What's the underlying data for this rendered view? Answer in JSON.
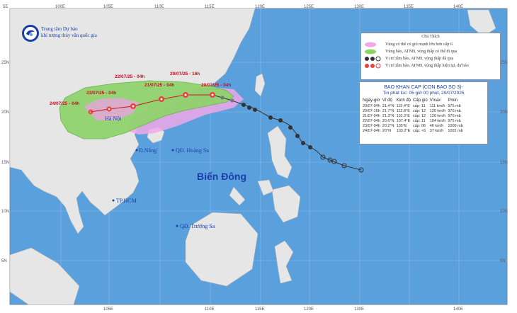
{
  "org": {
    "line1": "Trung tâm Dự báo",
    "line2": "khí tượng thủy văn quốc gia"
  },
  "axes": {
    "lon_top": [
      "5E",
      "100E",
      "105E",
      "110E",
      "115E",
      "120E",
      "125E",
      "130E",
      "135E",
      "140E"
    ],
    "lon_bottom": [
      "105E",
      "110E",
      "115E",
      "120E",
      "130E",
      "140E"
    ],
    "lat_left": [
      "25N",
      "20N",
      "15N",
      "10N",
      "5N"
    ],
    "lat_right": [
      "25N",
      "20N",
      "15N",
      "10N",
      "5N"
    ]
  },
  "legend": {
    "title": "Chú Thích",
    "items": [
      {
        "text": "Vùng có thể có gió mạnh lớn hơn cấp 6",
        "color": "#f0a8e8"
      },
      {
        "text": "Vùng bão, ATNĐ, vùng thấp có thể đi qua",
        "color": "#8ed36a"
      },
      {
        "text": "Vị trí tâm bão, ATNĐ, vùng thấp đã qua",
        "color": "#333333"
      },
      {
        "text": "Vị trí tâm bão, ATNĐ, vùng thấp hiện tại, dự báo",
        "color": "#e8403a"
      }
    ]
  },
  "info": {
    "title": "BAO KHAN CAP (CON BAO SO 3)-",
    "issued": "Tin phát lúc: 05 giờ 00 phút, 20/07/2025",
    "columns": [
      "Ngày-giờ",
      "Vĩ độ",
      "Kinh độ",
      "Cấp gió",
      "Vmax",
      "Pmin"
    ],
    "rows": [
      [
        "20/07-04h",
        "21.4°N",
        "115.4°E",
        "cấp: 11",
        "111 km/h",
        "975 mb"
      ],
      [
        "20/07-16h",
        "21.7°N",
        "112.8°E",
        "cấp: 12",
        "120 km/h",
        "970 mb"
      ],
      [
        "21/07-04h",
        "21.3°N",
        "110.3°E",
        "cấp: 12",
        "120 km/h",
        "970 mb"
      ],
      [
        "22/07-04h",
        "20.6°N",
        "107.4°E",
        "cấp: 11",
        "104 km/h",
        "975 mb"
      ],
      [
        "23/07-04h",
        "20.2°N",
        "105°E",
        "cấp: 06",
        "46 km/h",
        "1000 mb"
      ],
      [
        "24/07-04h",
        "20°N",
        "103.2°E",
        "cấp: <6",
        "37 km/h",
        "1002 mb"
      ]
    ]
  },
  "places": {
    "sea": "Biển Đông",
    "danang": "Đ.Nẵng",
    "hoangsa": "QĐ. Hoàng Sa",
    "hcm": "TP.HCM",
    "truongsa": "QĐ. Trường Sa",
    "hanoi": "Hà Nội"
  },
  "forecast_labels": {
    "l1": "22/07/25 - 04h",
    "l2": "20/07/25 - 16h",
    "l3": "23/07/25 - 04h",
    "l4": "21/07/25 - 04h",
    "l5": "20/07/25 - 04h",
    "l6": "24/07/25 - 04h"
  },
  "colors": {
    "sea": "#5aa0dc",
    "land": "#e6e6e6",
    "cone": "#8ed36a",
    "wind": "#f0a8e8",
    "storm": "#e8403a",
    "past": "#333333"
  }
}
